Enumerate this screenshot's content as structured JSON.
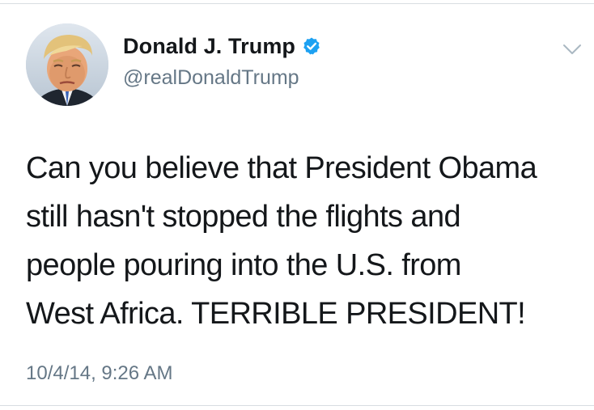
{
  "author": {
    "display_name": "Donald J. Trump",
    "handle": "@realDonaldTrump",
    "verified": true,
    "avatar_icon": "profile-photo"
  },
  "tweet": {
    "text": "Can you believe that President Obama\nstill hasn't stopped the flights and\npeople pouring into the U.S. from\nWest Africa. TERRIBLE PRESIDENT!",
    "timestamp": "10/4/14, 9:26 AM"
  },
  "icons": {
    "verified": "verified-badge-icon",
    "menu": "chevron-down-icon"
  },
  "colors": {
    "verified_blue": "#1da1f2",
    "secondary_text": "#657786",
    "primary_text": "#14171a",
    "divider": "#d8dde1"
  }
}
